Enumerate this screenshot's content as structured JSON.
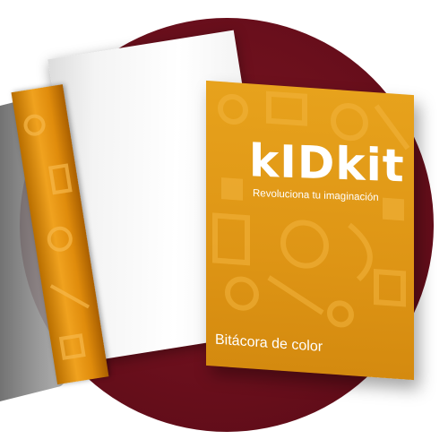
{
  "product": {
    "brand": "kIDkit",
    "tagline": "Revoluciona tu imaginación",
    "cover_title": "Bitácora de color"
  },
  "colors": {
    "background": "#ffffff",
    "circle": "#6a0f1c",
    "cover": "#e19a18",
    "spine": "#f0a21f",
    "text": "#ffffff"
  }
}
